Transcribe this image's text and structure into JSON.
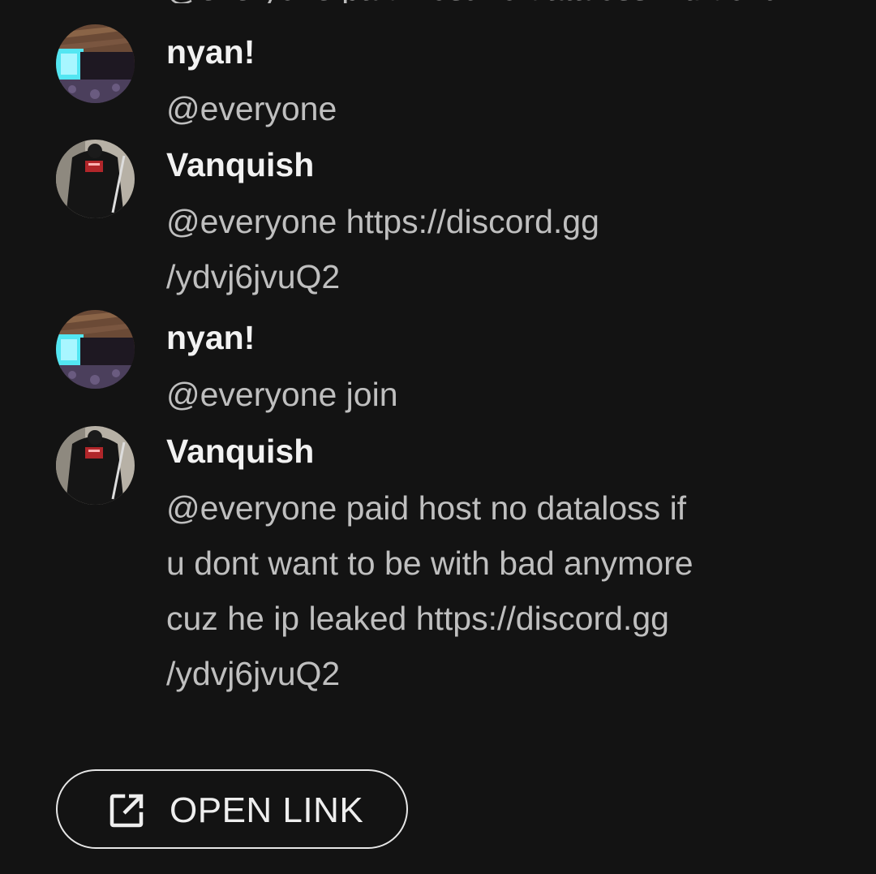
{
  "messages": [
    {
      "author": "nyan!",
      "avatar": "nyan-avatar",
      "lines": [
        "@everyone"
      ]
    },
    {
      "author": "Vanquish",
      "avatar": "vanquish-avatar",
      "lines": [
        "@everyone https://discord.gg",
        "/ydvj6jvuQ2"
      ]
    },
    {
      "author": "nyan!",
      "avatar": "nyan-avatar",
      "lines": [
        "@everyone join"
      ]
    },
    {
      "author": "Vanquish",
      "avatar": "vanquish-avatar",
      "lines": [
        "@everyone paid host no dataloss if",
        "u dont want to be with bad anymore",
        "cuz he ip leaked https://discord.gg",
        "/ydvj6jvuQ2"
      ]
    }
  ],
  "action": {
    "label": "OPEN LINK",
    "icon": "open-in-new-icon"
  },
  "colors": {
    "background": "#131313",
    "author": "#f2f2f2",
    "body": "#bfbfbf",
    "button_border": "#e6e6e6"
  }
}
